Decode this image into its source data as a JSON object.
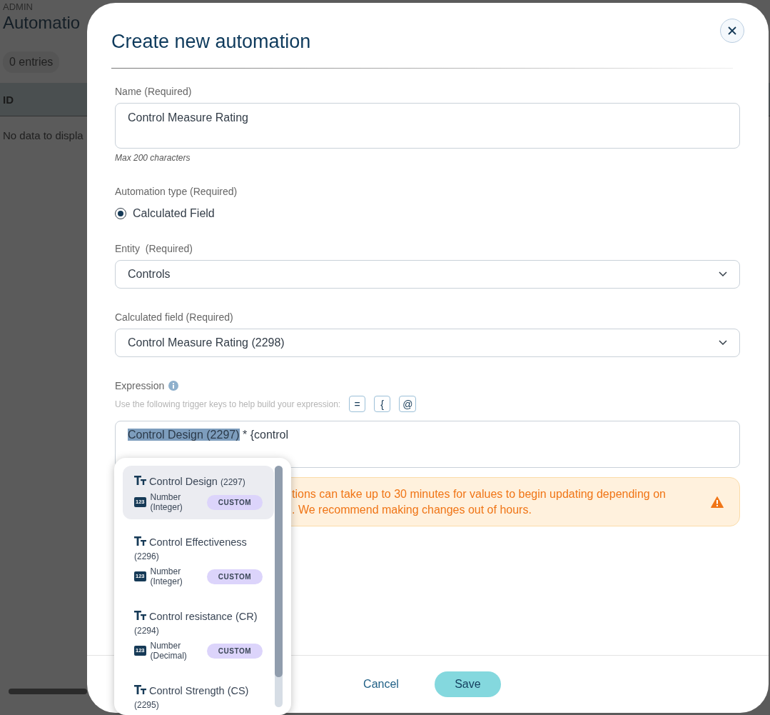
{
  "background": {
    "section": "ADMIN",
    "title": "Automatio",
    "entries": "0 entries",
    "column_1": "ID",
    "empty": "No data to displa"
  },
  "dialog": {
    "title": "Create new automation",
    "fields": [
      {
        "kind": "text",
        "label": "Name (Required)",
        "value": "Control Measure Rating",
        "hint": "Max 200 characters"
      },
      {
        "kind": "radio",
        "label": "Automation type (Required)",
        "options": [
          {
            "label": "Calculated Field",
            "selected": true
          }
        ]
      },
      {
        "kind": "select",
        "label": "Entity  (Required)",
        "value": "Controls"
      },
      {
        "kind": "select",
        "label": "Calculated field (Required)",
        "value": "Control Measure Rating (2298)"
      },
      {
        "kind": "expression",
        "label": "Expression",
        "hint": "Use the following trigger keys to help build your expression:",
        "keys": [
          "=",
          "{",
          "@"
        ],
        "token": "Control Design (2297)",
        "text": " * {control"
      }
    ],
    "warning": {
      "lines": [
        "tions can take up to 30 minutes for values to begin updating depending on",
        ". We recommend making changes out of hours."
      ]
    },
    "buttons": [
      {
        "kind": "text",
        "label": "Cancel"
      },
      {
        "kind": "primary",
        "label": "Save"
      }
    ]
  },
  "suggestions": {
    "items": [
      {
        "name": "Control Design",
        "id": "(2297)",
        "type_badge": "123",
        "type": "Number (Integer)",
        "tag": "CUSTOM",
        "selected": true
      },
      {
        "name": "Control Effectiveness",
        "id": "(2296)",
        "type_badge": "123",
        "type": "Number (Integer)",
        "tag": "CUSTOM",
        "selected": false
      },
      {
        "name": "Control resistance (CR)",
        "id": "(2294)",
        "type_badge": "123",
        "type": "Number (Decimal)",
        "tag": "CUSTOM",
        "selected": false
      },
      {
        "name": "Control Strength (CS)",
        "id": "(2295)",
        "selected": false
      }
    ]
  }
}
